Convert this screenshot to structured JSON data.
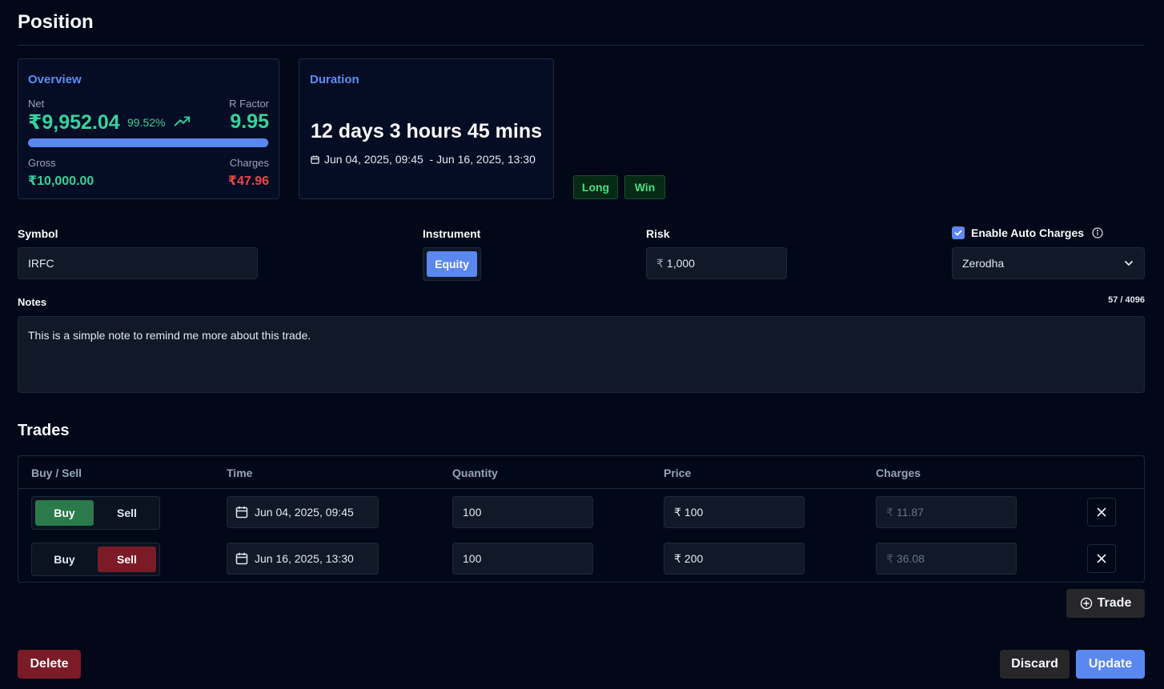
{
  "page": {
    "title": "Position"
  },
  "overview": {
    "title": "Overview",
    "net_label": "Net",
    "net_value": "₹9,952.04",
    "net_percent": "99.52%",
    "r_factor_label": "R Factor",
    "r_factor_value": "9.95",
    "progress_fraction": 0.9952,
    "gross_label": "Gross",
    "gross_value": "₹10,000.00",
    "charges_label": "Charges",
    "charges_value": "₹47.96"
  },
  "duration": {
    "title": "Duration",
    "text": "12 days 3 hours 45 mins",
    "range": "Jun 04, 2025, 09:45  - Jun 16, 2025, 13:30"
  },
  "tags": {
    "direction": "Long",
    "result": "Win"
  },
  "form": {
    "symbol_label": "Symbol",
    "symbol_value": "IRFC",
    "instrument_label": "Instrument",
    "instrument_value": "Equity",
    "risk_label": "Risk",
    "risk_currency": "₹",
    "risk_value": "1,000",
    "auto_charges_label": "Enable Auto Charges",
    "auto_charges_checked": true,
    "broker_value": "Zerodha",
    "notes_label": "Notes",
    "notes_count": "57 / 4096",
    "notes_value": "This is a simple note to remind me more about this trade."
  },
  "trades": {
    "title": "Trades",
    "columns": [
      "Buy / Sell",
      "Time",
      "Quantity",
      "Price",
      "Charges"
    ],
    "buy_label": "Buy",
    "sell_label": "Sell",
    "currency": "₹",
    "rows": [
      {
        "side": "buy",
        "time": "Jun 04, 2025, 09:45",
        "quantity": "100",
        "price": "100",
        "charges": "11.87"
      },
      {
        "side": "sell",
        "time": "Jun 16, 2025, 13:30",
        "quantity": "100",
        "price": "200",
        "charges": "36.08"
      }
    ],
    "add_label": "Trade"
  },
  "actions": {
    "delete_label": "Delete",
    "discard_label": "Discard",
    "update_label": "Update"
  },
  "colors": {
    "accent": "#5b87f0",
    "profit": "#34d399",
    "loss": "#ef4444",
    "buy": "#2a7a4b",
    "sell": "#7a1b27",
    "background": "#020817"
  },
  "icons": [
    "trend-up-icon",
    "calendar-icon",
    "check-icon",
    "info-icon",
    "chevron-down-icon",
    "close-icon",
    "plus-circle-icon"
  ]
}
